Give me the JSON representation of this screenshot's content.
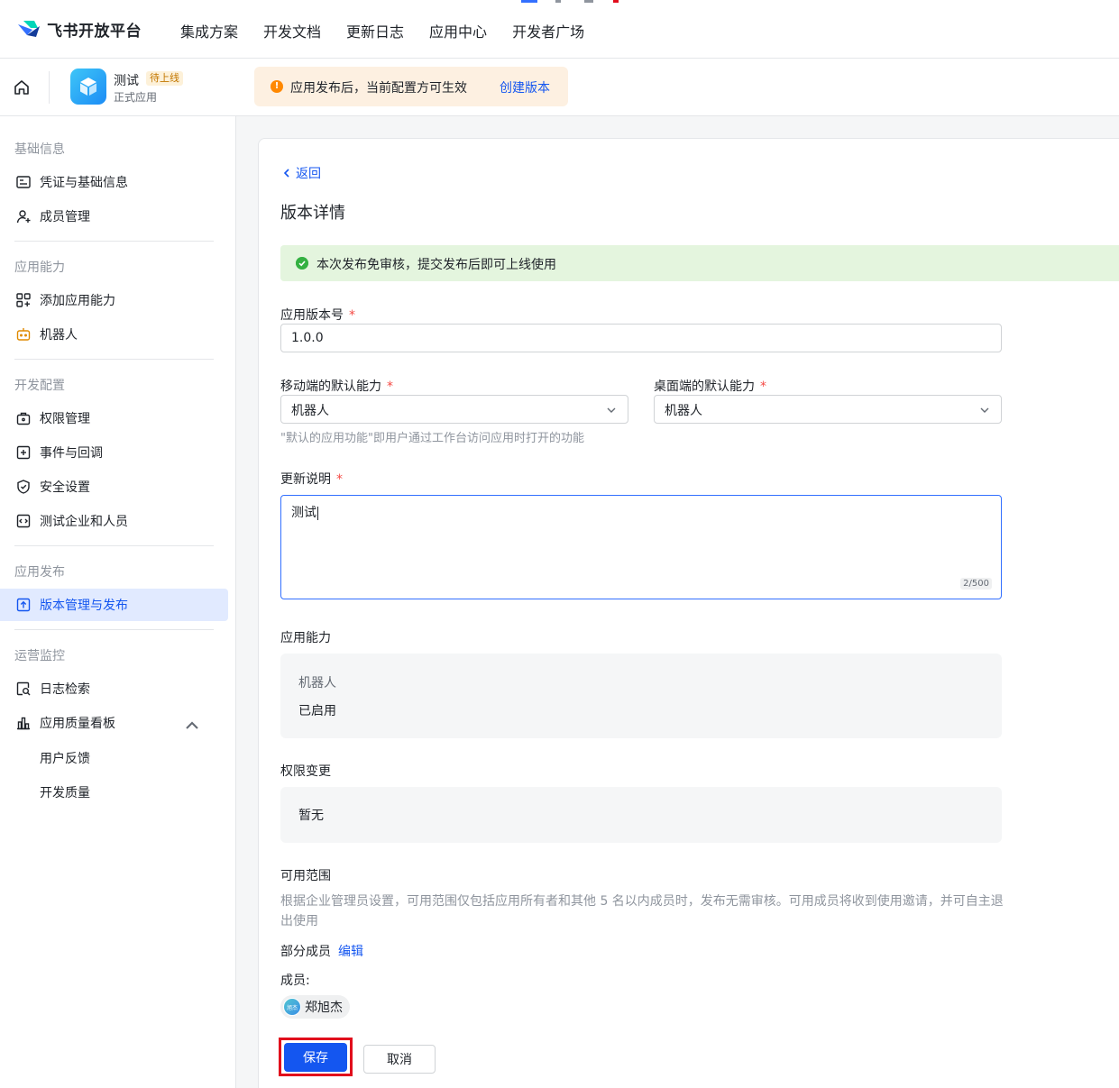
{
  "colors": {
    "brand": "#1456f0",
    "danger_outline": "#e10d1c",
    "success": "#34b142",
    "warning": "#ff8800"
  },
  "topnav": {
    "brand": "飞书开放平台",
    "links": [
      "集成方案",
      "开发文档",
      "更新日志",
      "应用中心",
      "开发者广场"
    ]
  },
  "app": {
    "name": "测试",
    "badge": "待上线",
    "type": "正式应用",
    "notice_icon": "!",
    "notice": "应用发布后，当前配置方可生效",
    "notice_action": "创建版本"
  },
  "sidebar": {
    "groups": {
      "basic": "基础信息",
      "ability": "应用能力",
      "dev": "开发配置",
      "release": "应用发布",
      "ops": "运营监控"
    },
    "items": {
      "credentials": "凭证与基础信息",
      "members": "成员管理",
      "add_ability": "添加应用能力",
      "bot": "机器人",
      "permissions": "权限管理",
      "events": "事件与回调",
      "security": "安全设置",
      "test_tenant": "测试企业和人员",
      "version": "版本管理与发布",
      "log_search": "日志检索",
      "quality_board": "应用质量看板",
      "feedback": "用户反馈",
      "dev_quality": "开发质量"
    }
  },
  "main": {
    "back": "返回",
    "title": "版本详情",
    "success_msg": "本次发布免审核，提交发布后即可上线使用",
    "version_label": "应用版本号",
    "version_value": "1.0.0",
    "mobile_label": "移动端的默认能力",
    "mobile_value": "机器人",
    "desktop_label": "桌面端的默认能力",
    "desktop_value": "机器人",
    "default_hint": "\"默认的应用功能\"即用户通过工作台访问应用时打开的功能",
    "notes_label": "更新说明",
    "notes_value": "测试",
    "notes_counter": "2/500",
    "ability_label": "应用能力",
    "ability_name": "机器人",
    "ability_status": "已启用",
    "perm_label": "权限变更",
    "perm_value": "暂无",
    "scope_label": "可用范围",
    "scope_desc": "根据企业管理员设置，可用范围仅包括应用所有者和其他 5 名以内成员时，发布无需审核。可用成员将收到使用邀请，并可自主退出使用",
    "scope_mode": "部分成员",
    "scope_edit": "编辑",
    "members_label": "成员:",
    "member_avatar_text": "旭杰",
    "member_name": "郑旭杰",
    "save": "保存",
    "cancel": "取消"
  }
}
